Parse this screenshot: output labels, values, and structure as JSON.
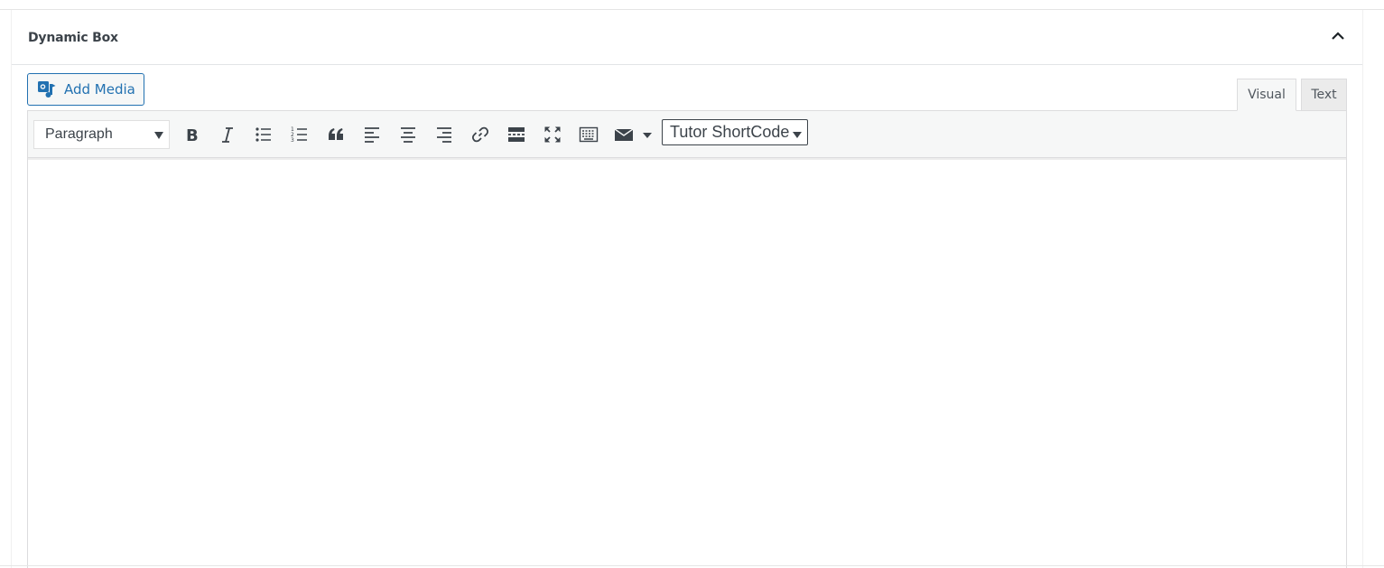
{
  "metabox": {
    "title": "Dynamic Box",
    "toggle_icon": "chevron-up-icon"
  },
  "add_media": {
    "label": "Add Media",
    "icon": "media-icon"
  },
  "tabs": [
    {
      "label": "Visual",
      "active": true
    },
    {
      "label": "Text",
      "active": false
    }
  ],
  "toolbar": {
    "format_select": {
      "value": "Paragraph"
    },
    "buttons": [
      {
        "name": "bold",
        "icon": "bold-icon"
      },
      {
        "name": "italic",
        "icon": "italic-icon"
      },
      {
        "name": "bullet-list",
        "icon": "bullet-list-icon"
      },
      {
        "name": "numbered-list",
        "icon": "numbered-list-icon"
      },
      {
        "name": "blockquote",
        "icon": "quote-icon"
      },
      {
        "name": "align-left",
        "icon": "align-left-icon"
      },
      {
        "name": "align-center",
        "icon": "align-center-icon"
      },
      {
        "name": "align-right",
        "icon": "align-right-icon"
      },
      {
        "name": "insert-link",
        "icon": "link-icon"
      },
      {
        "name": "read-more",
        "icon": "read-more-icon"
      },
      {
        "name": "fullscreen",
        "icon": "fullscreen-icon"
      },
      {
        "name": "toolbar-toggle",
        "icon": "keyboard-icon"
      },
      {
        "name": "email",
        "icon": "envelope-icon"
      }
    ],
    "shortcode_select": {
      "value": "Tutor ShortCode"
    }
  },
  "editor_content": "",
  "colors": {
    "accent": "#2271b1",
    "toolbar_bg": "#f6f7f7",
    "border": "#dcdcde",
    "icon": "#3c434a"
  }
}
